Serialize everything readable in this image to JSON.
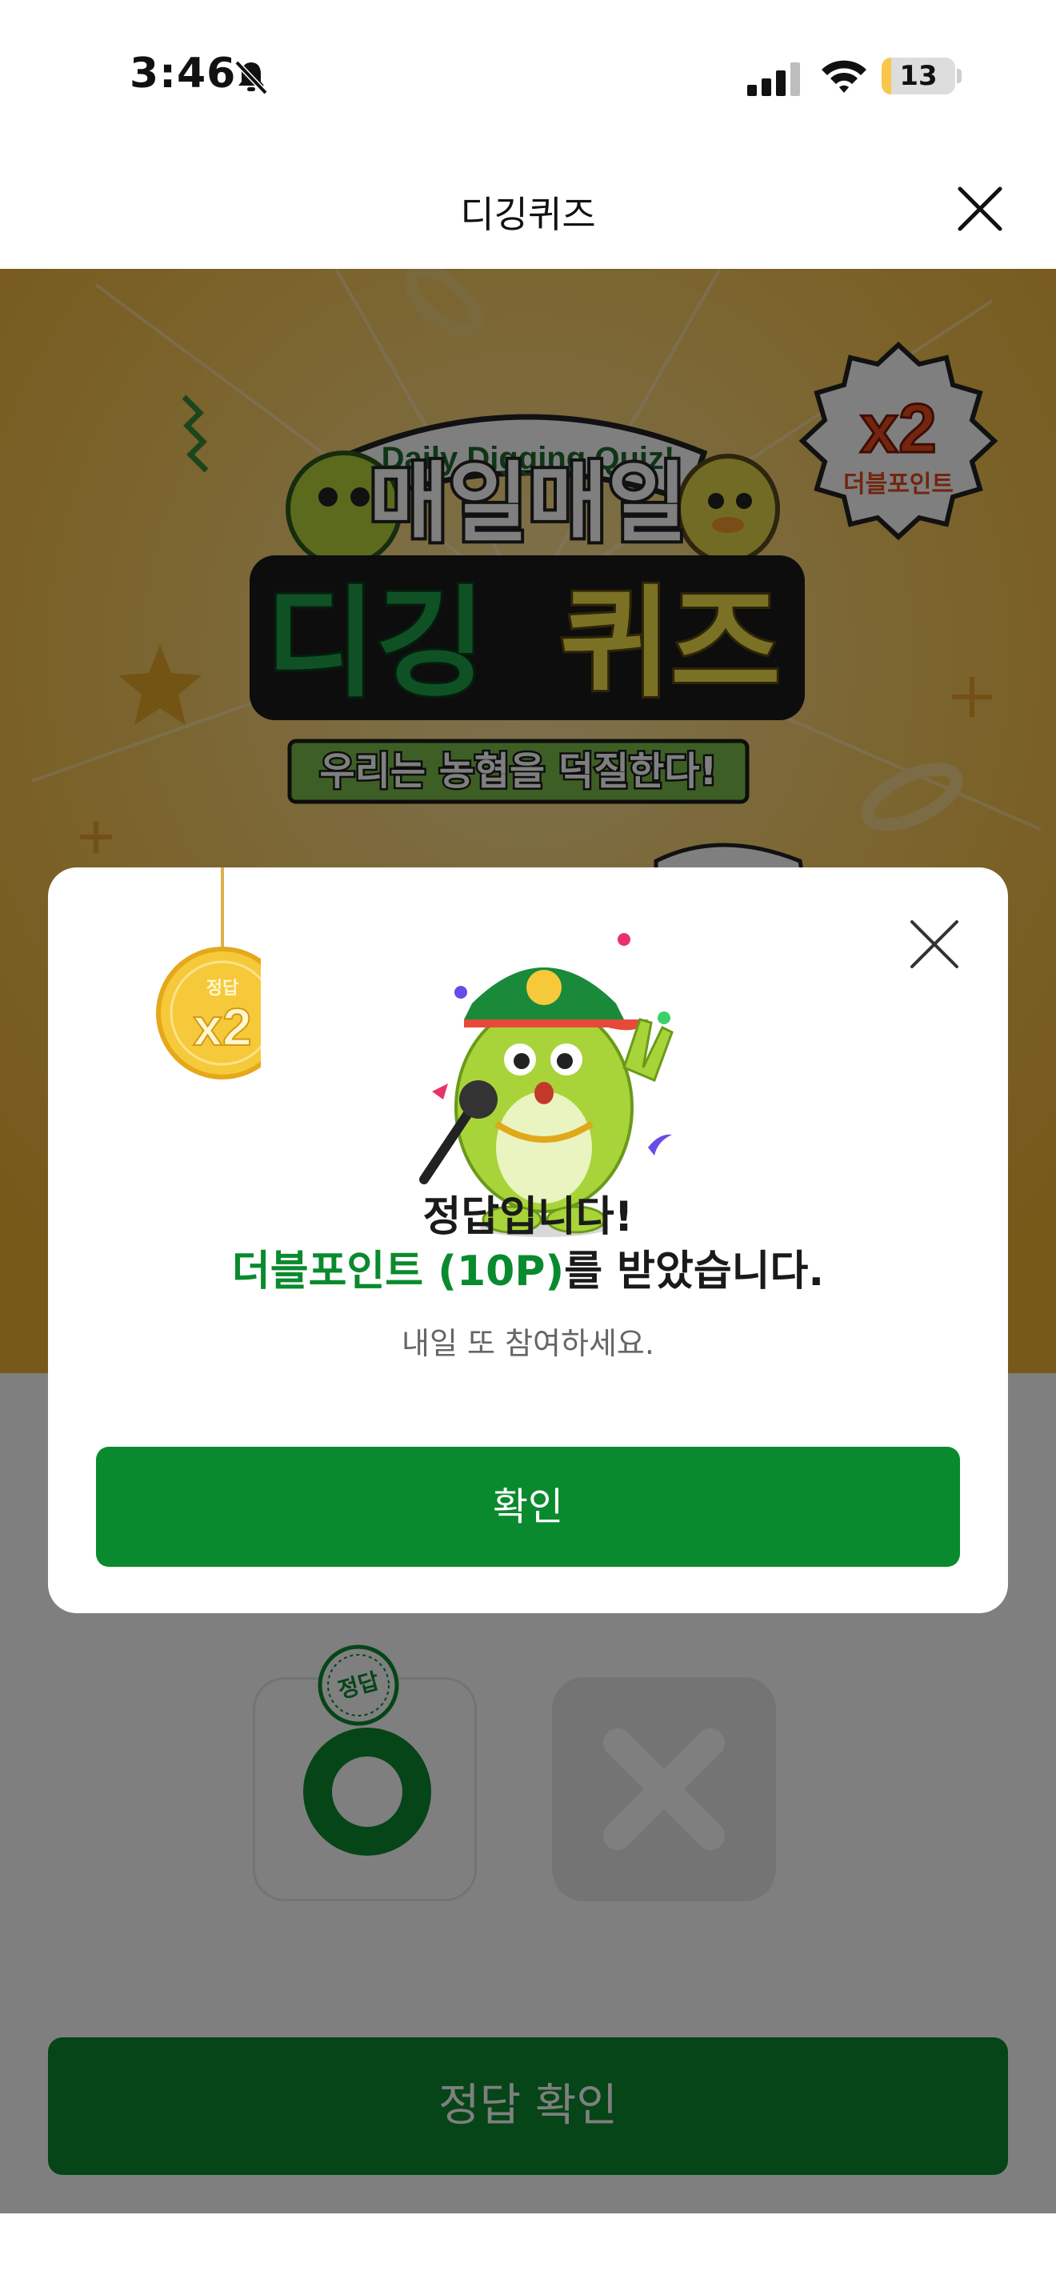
{
  "status": {
    "time": "3:46",
    "battery": "13",
    "battery_level_percent": 13
  },
  "header": {
    "title": "디깅퀴즈"
  },
  "banner": {
    "tagline": "Daily Digging Quiz!",
    "headline_line1": "매일매일",
    "headline_line2_green": "디깅",
    "headline_line2_yellow": "퀴즈",
    "subheadline": "우리는 농협을 덕질한다!",
    "badge_multiplier": "x2",
    "badge_label": "더블포인트"
  },
  "answers": {
    "stamp_label": "정답"
  },
  "bottom_button": "정답 확인",
  "modal": {
    "medal_label": "정답",
    "medal_multiplier": "x2",
    "line1": "정답입니다!",
    "line2_accent": "더블포인트 (10P)",
    "line2_rest": "를 받았습니다.",
    "subtext": "내일 또 참여하세요.",
    "confirm": "확인"
  },
  "colors": {
    "brand_green": "#0a8a2e",
    "banner_yellow": "#f5c04c"
  }
}
